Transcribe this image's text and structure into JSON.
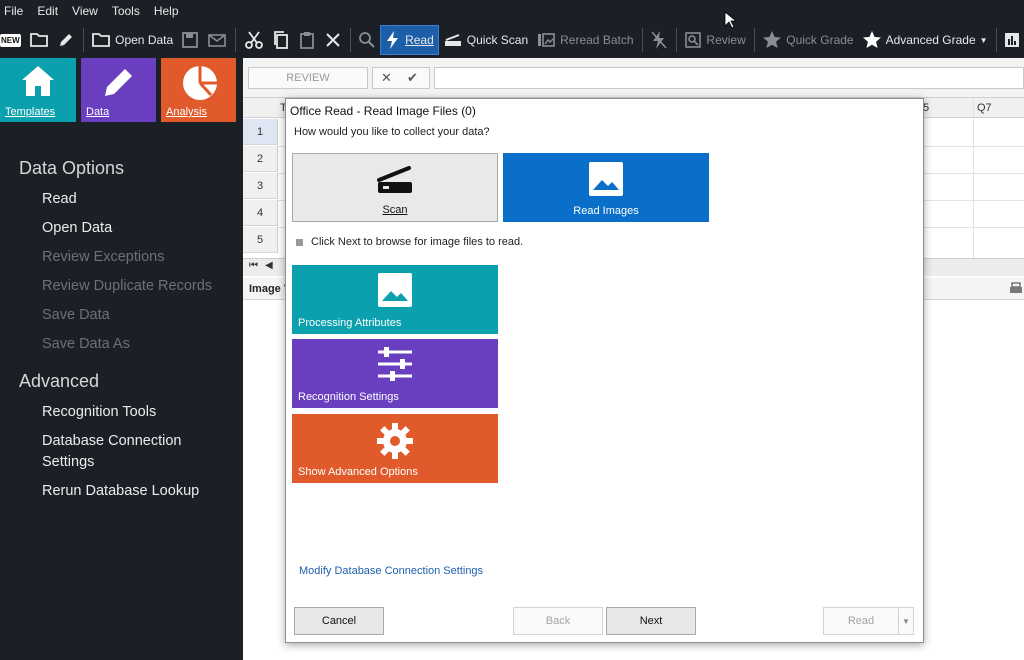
{
  "menu": [
    "File",
    "Edit",
    "View",
    "Tools",
    "Help"
  ],
  "toolbar": {
    "new_label": "NEW",
    "open_data": "Open Data",
    "read": "Read",
    "quick_scan": "Quick Scan",
    "reread_batch": "Reread Batch",
    "review": "Review",
    "quick_grade": "Quick Grade",
    "advanced_grade": "Advanced Grade"
  },
  "tiles": {
    "templates": "Templates",
    "data": "Data",
    "analysis": "Analysis"
  },
  "sidebar": {
    "data_options_title": "Data Options",
    "data_options": [
      {
        "label": "Read",
        "enabled": true
      },
      {
        "label": "Open Data",
        "enabled": true
      },
      {
        "label": "Review Exceptions",
        "enabled": false
      },
      {
        "label": "Review Duplicate Records",
        "enabled": false
      },
      {
        "label": "Save Data",
        "enabled": false
      },
      {
        "label": "Save Data As",
        "enabled": false
      }
    ],
    "advanced_title": "Advanced",
    "advanced": [
      {
        "label": "Recognition Tools"
      },
      {
        "label": "Database Connection Settings"
      },
      {
        "label": "Rerun Database Lookup"
      }
    ]
  },
  "sheet": {
    "review_button": "REVIEW",
    "col_first": "T",
    "col_q6_fragment": "5",
    "col_q7": "Q7",
    "rows": [
      "1",
      "2",
      "3",
      "4",
      "5"
    ],
    "image_viewer_label": "Image V"
  },
  "dialog": {
    "title": "Office Read - Read Image Files (0)",
    "prompt": "How would you like to collect your data?",
    "scan_label": "Scan",
    "read_images_label": "Read Images",
    "hint": "Click Next to browse for image files to read.",
    "cards": [
      {
        "label": "Processing Attributes",
        "color": "#0aa0ad"
      },
      {
        "label": "Recognition Settings",
        "color": "#6a3fbf"
      },
      {
        "label": "Show Advanced Options",
        "color": "#e05a2c"
      }
    ],
    "link": "Modify Database Connection Settings",
    "buttons": {
      "cancel": "Cancel",
      "back": "Back",
      "next": "Next",
      "read": "Read"
    }
  },
  "colors": {
    "templates_tile": "#0aa0ad",
    "data_tile": "#6a3fbf",
    "analysis_tile": "#e05a2c",
    "selected_option": "#0a6fc9",
    "toolbar_active": "#1d5ea8"
  }
}
